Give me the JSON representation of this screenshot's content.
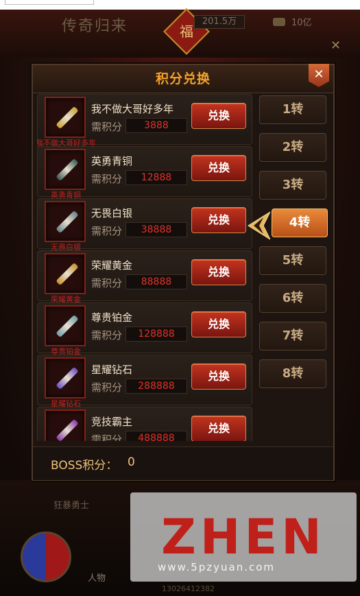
{
  "background": {
    "title": "传奇归来",
    "stat1": "201.5万",
    "stat2": "10亿",
    "fu_char": "福",
    "bottom_label": "狂暴勇士",
    "person_label": "人物",
    "phone_text": "13026412382"
  },
  "dialog": {
    "title": "积分兑换",
    "close_glyph": "✕",
    "need_label": "需积分",
    "exchange_label": "兑换",
    "items": [
      {
        "name": "我不做大哥好多年",
        "points": "3888",
        "icon_label": "我不做大哥好多年",
        "color": "#c9a334"
      },
      {
        "name": "英勇青铜",
        "points": "12888",
        "icon_label": "英勇青铜",
        "color": "#3a5a55"
      },
      {
        "name": "无畏白银",
        "points": "38888",
        "icon_label": "无畏白银",
        "color": "#6a7f8a"
      },
      {
        "name": "荣耀黄金",
        "points": "88888",
        "icon_label": "荣耀黄金",
        "color": "#c7922a"
      },
      {
        "name": "尊贵铂金",
        "points": "128888",
        "icon_label": "尊贵铂金",
        "color": "#6fa0a8"
      },
      {
        "name": "星耀钻石",
        "points": "288888",
        "icon_label": "星耀钻石",
        "color": "#6a4fc2"
      },
      {
        "name": "竞技霸主",
        "points": "488888",
        "icon_label": "",
        "color": "#8a3aa8"
      }
    ],
    "tiers": [
      "1转",
      "2转",
      "3转",
      "4转",
      "5转",
      "6转",
      "7转",
      "8转"
    ],
    "active_tier": "4转",
    "footer": {
      "boss_label": "BOSS积分：",
      "boss_value": "0"
    }
  },
  "watermark": {
    "text": "ZHEN",
    "url": "www.5pzyuan.com"
  }
}
